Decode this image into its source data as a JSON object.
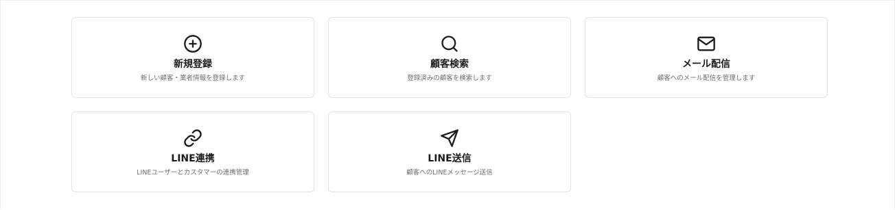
{
  "menu": {
    "cards": [
      {
        "icon": "plus-circle-icon",
        "title": "新規登録",
        "description": "新しい顧客・業者情報を登録します"
      },
      {
        "icon": "search-icon",
        "title": "顧客検索",
        "description": "登録済みの顧客を検索します"
      },
      {
        "icon": "mail-icon",
        "title": "メール配信",
        "description": "顧客へのメール配信を管理します"
      },
      {
        "icon": "link-icon",
        "title": "LINE連携",
        "description": "LINEユーザーとカスタマーの連携管理"
      },
      {
        "icon": "send-icon",
        "title": "LINE送信",
        "description": "顧客へのLINEメッセージ送信"
      }
    ]
  },
  "colors": {
    "card_border": "#e3e3e3",
    "title_text": "#1b1b1b",
    "description_text": "#6e6e6e",
    "icon_stroke": "#1b1b1b",
    "background": "#ffffff"
  }
}
